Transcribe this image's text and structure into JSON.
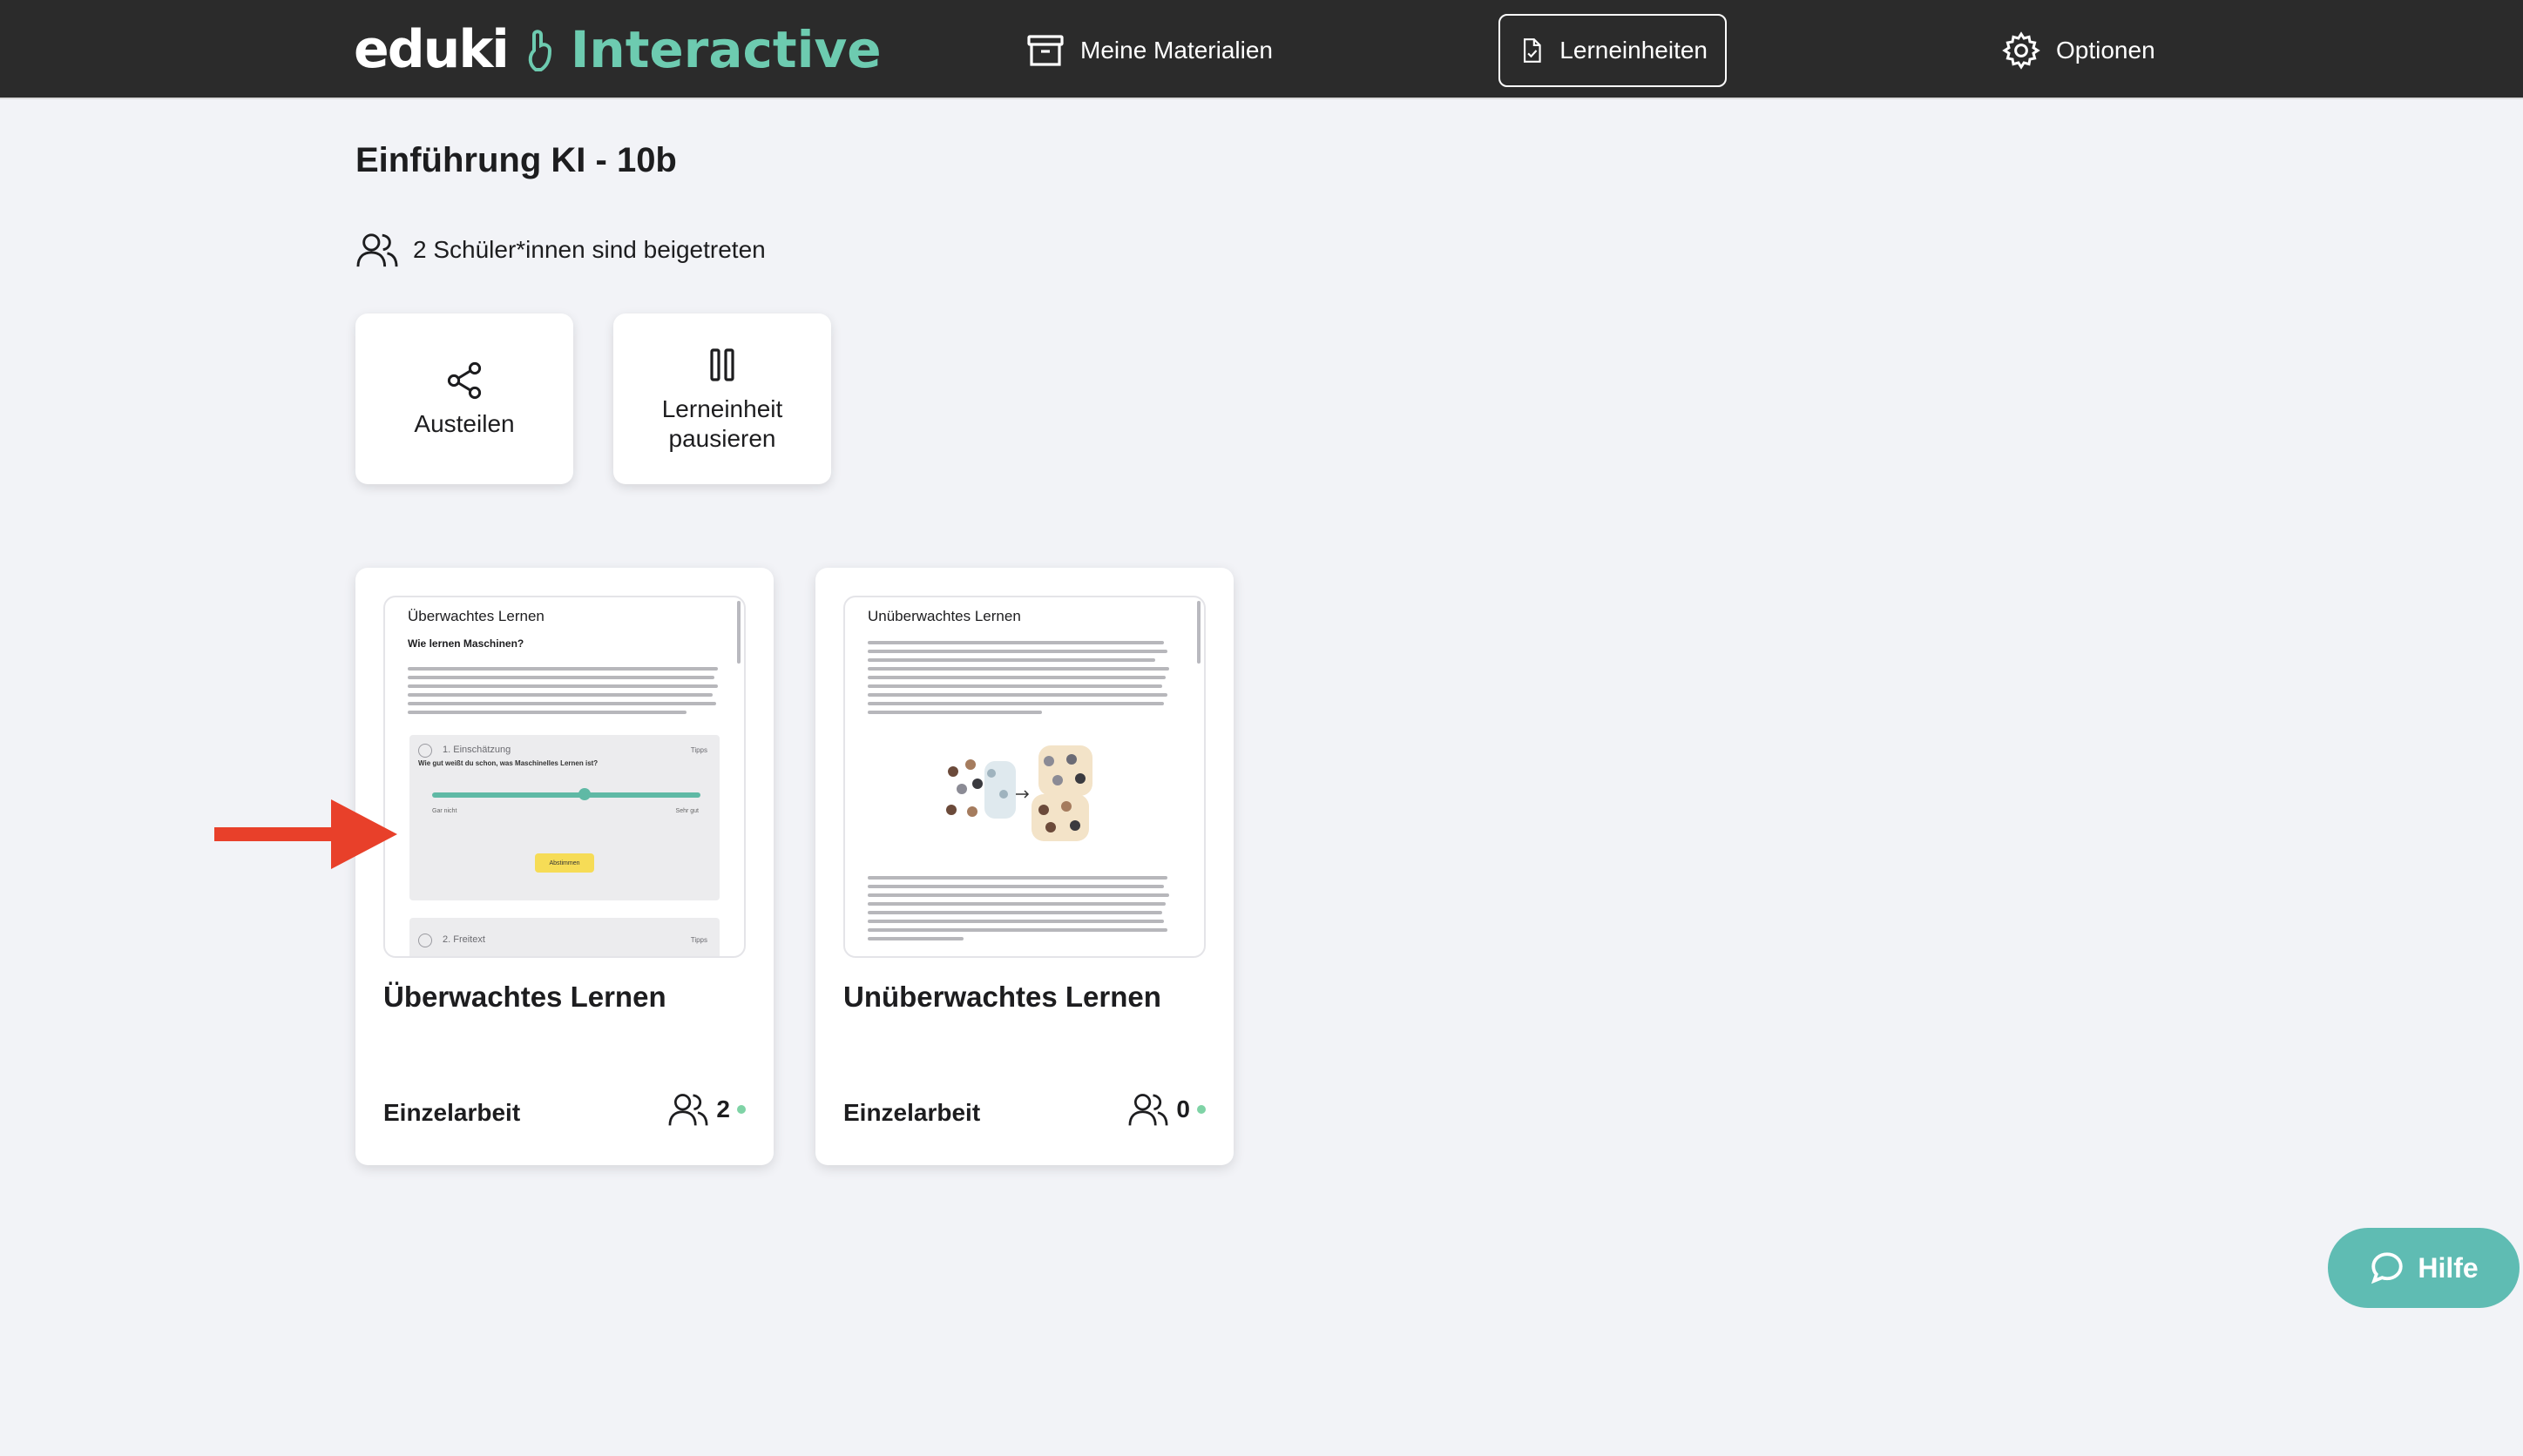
{
  "header": {
    "brand": "eduki",
    "product": "Interactive",
    "nav": [
      {
        "label": "Meine Materialien",
        "icon": "archive-icon"
      },
      {
        "label": "Lerneinheiten",
        "icon": "document-check-icon",
        "active": true
      },
      {
        "label": "Optionen",
        "icon": "gear-icon"
      }
    ]
  },
  "page": {
    "title": "Einführung KI - 10b",
    "joined_text": "2 Schüler*innen sind beigetreten"
  },
  "actions": {
    "share_label": "Austeilen",
    "pause_label_line1": "Lerneinheit",
    "pause_label_line2": "pausieren"
  },
  "cards": [
    {
      "title": "Überwachtes Lernen",
      "mode": "Einzelarbeit",
      "count": "2",
      "preview": {
        "title": "Überwachtes Lernen",
        "subtitle": "Wie lernen Maschinen?",
        "task1": "1. Einschätzung",
        "task1_tag": "Tipps",
        "question": "Wie gut weißt du schon, was Maschinelles Lernen ist?",
        "tick_left": "Gar nicht",
        "tick_right": "Sehr gut",
        "vote_button": "Abstimmen",
        "task2": "2. Freitext",
        "task2_tag": "Tipps"
      }
    },
    {
      "title": "Unüberwachtes Lernen",
      "mode": "Einzelarbeit",
      "count": "0",
      "preview": {
        "title": "Unüberwachtes Lernen"
      }
    }
  ],
  "help": {
    "label": "Hilfe"
  },
  "colors": {
    "topbar": "#2b2b2b",
    "accent": "#6dcbb0",
    "help": "#5fbcb3",
    "arrow": "#e8402a",
    "status_dot": "#7fd3a6"
  }
}
